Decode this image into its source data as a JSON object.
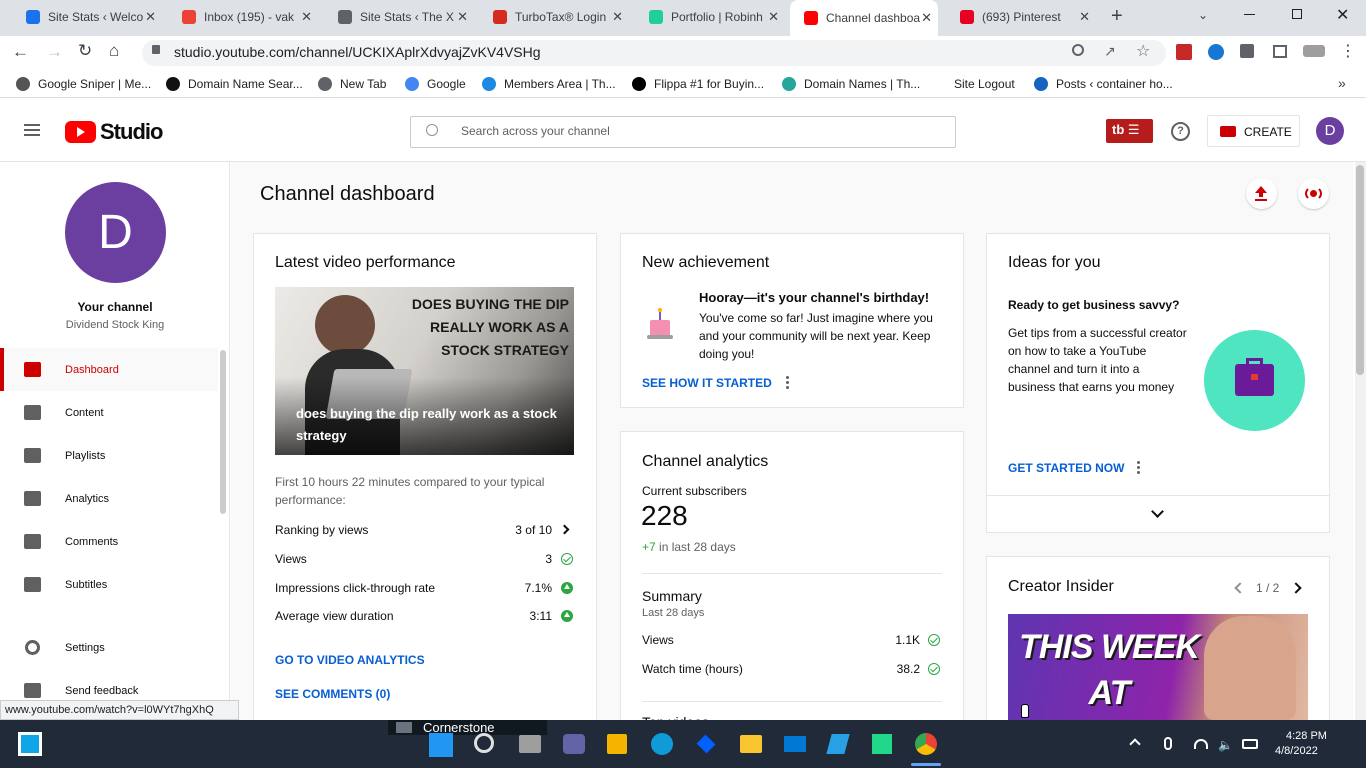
{
  "browser": {
    "tabs": [
      {
        "title": "Site Stats ‹ Welco",
        "color": "#1a73e8"
      },
      {
        "title": "Inbox (195) - vak",
        "color": "#ea4335"
      },
      {
        "title": "Site Stats ‹ The X",
        "color": "#5f6368"
      },
      {
        "title": "TurboTax® Login",
        "color": "#d52b1e"
      },
      {
        "title": "Portfolio | Robinh",
        "color": "#21ce99"
      },
      {
        "title": "Channel dashboa",
        "color": "#ff0000"
      },
      {
        "title": "(693) Pinterest",
        "color": "#e60023"
      }
    ],
    "new_tab": "+",
    "url": "studio.youtube.com/channel/UCKIXAplrXdvyajZvKV4VSHg",
    "bookmarks": [
      {
        "label": "Google Sniper | Me...",
        "color": "#555555"
      },
      {
        "label": "Domain Name Sear...",
        "color": "#111111"
      },
      {
        "label": "New Tab",
        "color": "#5f6368"
      },
      {
        "label": "Google",
        "color": "#4285f4"
      },
      {
        "label": "Members Area | Th...",
        "color": "#1e88e5"
      },
      {
        "label": "Flippa #1 for Buyin...",
        "color": "#000000"
      },
      {
        "label": "Domain Names | Th...",
        "color": "#26a69a"
      },
      {
        "label": "Site Logout",
        "color": "#ffffff"
      },
      {
        "label": "Posts ‹ container ho...",
        "color": "#1565c0"
      }
    ],
    "bookmarks_more": "»"
  },
  "studio": {
    "logo_text": "Studio",
    "search_placeholder": "Search across your channel",
    "tb_badge": "tb",
    "create_label": "CREATE",
    "avatar_letter": "D",
    "accent": "#cc0000"
  },
  "sidebar": {
    "avatar_letter": "D",
    "avatar_color": "#6b3fa0",
    "your_channel": "Your channel",
    "channel_name": "Dividend Stock King",
    "items": [
      {
        "label": "Dashboard",
        "icon": "dashboard-icon"
      },
      {
        "label": "Content",
        "icon": "content-icon"
      },
      {
        "label": "Playlists",
        "icon": "playlists-icon"
      },
      {
        "label": "Analytics",
        "icon": "analytics-icon"
      },
      {
        "label": "Comments",
        "icon": "comments-icon"
      },
      {
        "label": "Subtitles",
        "icon": "subtitles-icon"
      }
    ],
    "settings": "Settings",
    "feedback": "Send feedback"
  },
  "dashboard": {
    "title": "Channel dashboard",
    "latest": {
      "title": "Latest video performance",
      "thumb_overlay": "DOES BUYING THE DIP REALLY WORK AS A STOCK STRATEGY",
      "video_title": "does buying the dip really work as a stock strategy",
      "compare": "First 10 hours 22 minutes compared to your typical performance:",
      "stats": [
        {
          "label": "Ranking by views",
          "value": "3 of 10"
        },
        {
          "label": "Views",
          "value": "3"
        },
        {
          "label": "Impressions click-through rate",
          "value": "7.1%"
        },
        {
          "label": "Average view duration",
          "value": "3:11"
        }
      ],
      "go_analytics": "GO TO VIDEO ANALYTICS",
      "see_comments": "SEE COMMENTS (0)"
    },
    "achievement": {
      "title": "New achievement",
      "headline": "Hooray—it's your channel's birthday!",
      "body": "You've come so far! Just imagine where you and your community will be next year. Keep doing you!",
      "link": "SEE HOW IT STARTED"
    },
    "analytics": {
      "title": "Channel analytics",
      "subs_label": "Current subscribers",
      "subs_value": "228",
      "subs_change": "+7",
      "subs_change_suffix": "in last 28 days",
      "summary": "Summary",
      "summary_period": "Last 28 days",
      "rows": [
        {
          "label": "Views",
          "value": "1.1K"
        },
        {
          "label": "Watch time (hours)",
          "value": "38.2"
        }
      ],
      "cutoff": "Top videos"
    },
    "ideas": {
      "title": "Ideas for you",
      "headline": "Ready to get business savvy?",
      "body": "Get tips from a successful creator on how to take a YouTube channel and turn it into a business that earns you money",
      "link": "GET STARTED NOW"
    },
    "insider": {
      "title": "Creator Insider",
      "pager": "1 / 2",
      "thumb_text": "THIS WEEK AT"
    }
  },
  "status_url": "www.youtube.com/watch?v=l0WYt7hgXhQ",
  "taskbar": {
    "pinned_app": "Cornerstone",
    "time": "4:28 PM",
    "date": "4/8/2022"
  }
}
